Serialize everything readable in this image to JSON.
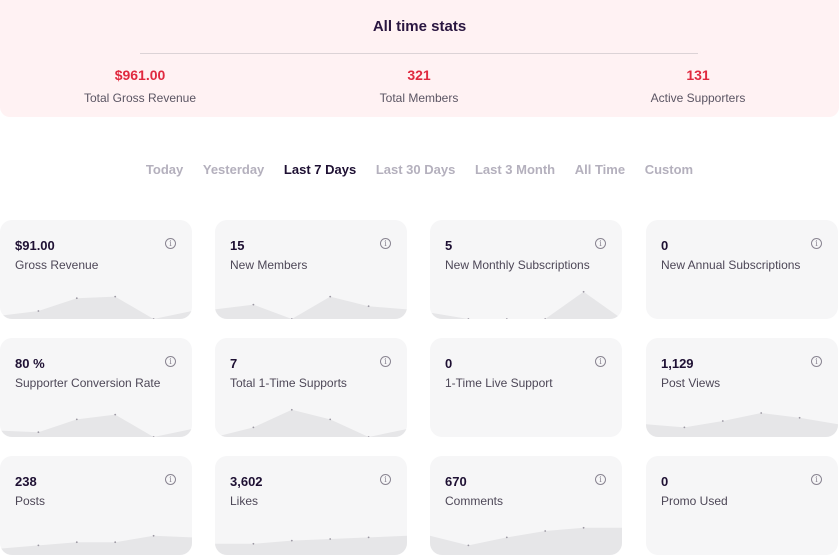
{
  "all_time": {
    "title": "All time stats",
    "stats": [
      {
        "value": "$961.00",
        "label": "Total Gross Revenue"
      },
      {
        "value": "321",
        "label": "Total Members"
      },
      {
        "value": "131",
        "label": "Active Supporters"
      }
    ]
  },
  "filters": [
    {
      "label": "Today",
      "active": false
    },
    {
      "label": "Yesterday",
      "active": false
    },
    {
      "label": "Last 7 Days",
      "active": true
    },
    {
      "label": "Last 30 Days",
      "active": false
    },
    {
      "label": "Last 3 Month",
      "active": false
    },
    {
      "label": "All Time",
      "active": false
    },
    {
      "label": "Custom",
      "active": false
    }
  ],
  "info_icon_glyph": "i",
  "cards": [
    {
      "value": "$91.00",
      "label": "Gross Revenue",
      "trend": [
        0.1,
        0.25,
        0.65,
        0.7,
        0.0,
        0.25
      ]
    },
    {
      "value": "15",
      "label": "New Members",
      "trend": [
        0.3,
        0.45,
        0.0,
        0.7,
        0.4,
        0.3
      ]
    },
    {
      "value": "5",
      "label": "New Monthly Subscriptions",
      "trend": [
        0.2,
        0.0,
        0.0,
        0.0,
        0.85,
        0.0
      ]
    },
    {
      "value": "0",
      "label": "New Annual Subscriptions",
      "trend": []
    },
    {
      "value": "80 %",
      "label": "Supporter Conversion Rate",
      "trend": [
        0.2,
        0.15,
        0.55,
        0.7,
        0.0,
        0.25
      ]
    },
    {
      "value": "7",
      "label": "Total 1-Time Supports",
      "trend": [
        0.0,
        0.3,
        0.85,
        0.55,
        0.0,
        0.25
      ]
    },
    {
      "value": "0",
      "label": "1-Time Live Support",
      "trend": []
    },
    {
      "value": "1,129",
      "label": "Post Views",
      "trend": [
        0.4,
        0.3,
        0.5,
        0.75,
        0.6,
        0.4
      ]
    },
    {
      "value": "238",
      "label": "Posts",
      "trend": [
        0.2,
        0.3,
        0.4,
        0.4,
        0.6,
        0.55
      ]
    },
    {
      "value": "3,602",
      "label": "Likes",
      "trend": [
        0.35,
        0.35,
        0.45,
        0.5,
        0.55,
        0.6
      ]
    },
    {
      "value": "670",
      "label": "Comments",
      "trend": [
        0.6,
        0.3,
        0.55,
        0.75,
        0.85,
        0.85
      ]
    },
    {
      "value": "0",
      "label": "Promo Used",
      "trend": []
    }
  ],
  "colors": {
    "accent": "#e0293f",
    "spark_fill": "#e6e6e8",
    "spark_dot": "#9c98a3"
  }
}
